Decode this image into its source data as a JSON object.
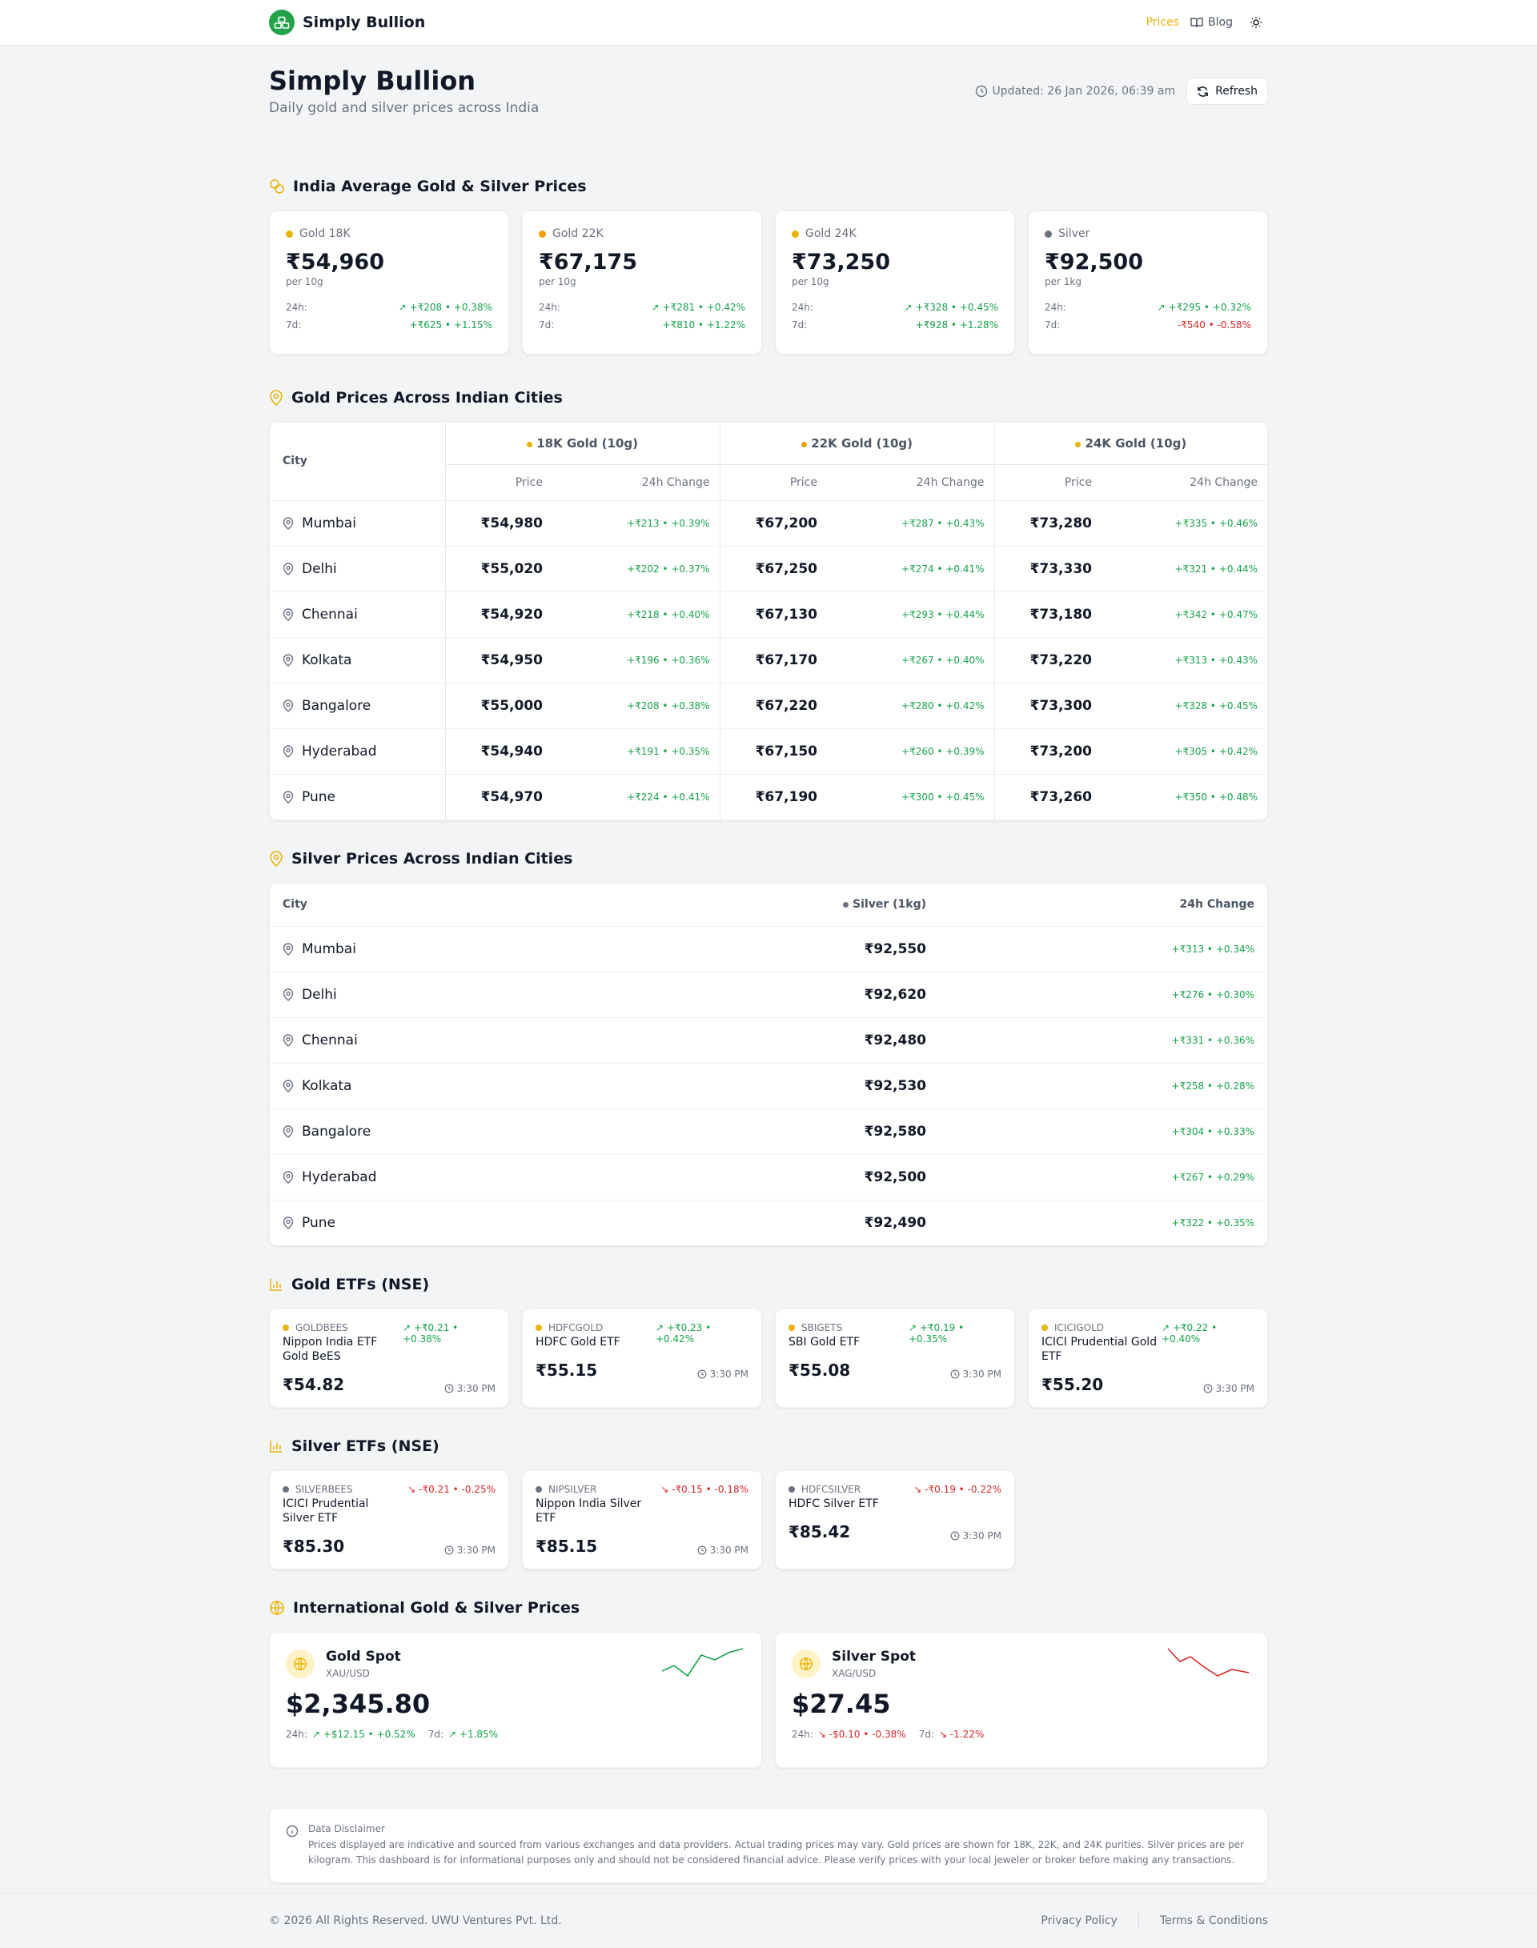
{
  "nav": {
    "brand": "Simply Bullion",
    "prices_label": "Prices",
    "blog_label": "Blog"
  },
  "header": {
    "title": "Simply Bullion",
    "subtitle": "Daily gold and silver prices across India",
    "updated": "Updated: 26 Jan 2026, 06:39 am",
    "refresh_label": "Refresh"
  },
  "colors": {
    "gold18": "#eab308",
    "gold22": "#f59e0b",
    "gold24": "#eab308",
    "silver": "#6b7280",
    "up": "#16a34a",
    "down": "#dc2626"
  },
  "avg": {
    "title": "India Average Gold & Silver Prices",
    "cards": [
      {
        "label": "Gold 18K",
        "price": "₹54,960",
        "unit": "per 10g",
        "k24": "24h:",
        "v24": "↗ +₹208 • +0.38%",
        "k7": "7d:",
        "v7": "+₹625 • +1.15%"
      },
      {
        "label": "Gold 22K",
        "price": "₹67,175",
        "unit": "per 10g",
        "k24": "24h:",
        "v24": "↗ +₹281 • +0.42%",
        "k7": "7d:",
        "v7": "+₹810 • +1.22%"
      },
      {
        "label": "Gold 24K",
        "price": "₹73,250",
        "unit": "per 10g",
        "k24": "24h:",
        "v24": "↗ +₹328 • +0.45%",
        "k7": "7d:",
        "v7": "+₹928 • +1.28%"
      },
      {
        "label": "Silver",
        "price": "₹92,500",
        "unit": "per 1kg",
        "k24": "24h:",
        "v24": "↗ +₹295 • +0.32%",
        "k7": "7d:",
        "v7": "-₹540 • -0.58%"
      }
    ]
  },
  "gold_cities": {
    "title": "Gold Prices Across Indian Cities",
    "city_header": "City",
    "groups": [
      "18K Gold (10g)",
      "22K Gold (10g)",
      "24K Gold (10g)"
    ],
    "price_header": "Price",
    "change_header": "24h Change",
    "rows": [
      {
        "city": "Mumbai",
        "p18": "₹54,980",
        "c18": "+₹213 • +0.39%",
        "p22": "₹67,200",
        "c22": "+₹287 • +0.43%",
        "p24": "₹73,280",
        "c24": "+₹335 • +0.46%"
      },
      {
        "city": "Delhi",
        "p18": "₹55,020",
        "c18": "+₹202 • +0.37%",
        "p22": "₹67,250",
        "c22": "+₹274 • +0.41%",
        "p24": "₹73,330",
        "c24": "+₹321 • +0.44%"
      },
      {
        "city": "Chennai",
        "p18": "₹54,920",
        "c18": "+₹218 • +0.40%",
        "p22": "₹67,130",
        "c22": "+₹293 • +0.44%",
        "p24": "₹73,180",
        "c24": "+₹342 • +0.47%"
      },
      {
        "city": "Kolkata",
        "p18": "₹54,950",
        "c18": "+₹196 • +0.36%",
        "p22": "₹67,170",
        "c22": "+₹267 • +0.40%",
        "p24": "₹73,220",
        "c24": "+₹313 • +0.43%"
      },
      {
        "city": "Bangalore",
        "p18": "₹55,000",
        "c18": "+₹208 • +0.38%",
        "p22": "₹67,220",
        "c22": "+₹280 • +0.42%",
        "p24": "₹73,300",
        "c24": "+₹328 • +0.45%"
      },
      {
        "city": "Hyderabad",
        "p18": "₹54,940",
        "c18": "+₹191 • +0.35%",
        "p22": "₹67,150",
        "c22": "+₹260 • +0.39%",
        "p24": "₹73,200",
        "c24": "+₹305 • +0.42%"
      },
      {
        "city": "Pune",
        "p18": "₹54,970",
        "c18": "+₹224 • +0.41%",
        "p22": "₹67,190",
        "c22": "+₹300 • +0.45%",
        "p24": "₹73,260",
        "c24": "+₹350 • +0.48%"
      }
    ]
  },
  "silver_cities": {
    "title": "Silver Prices Across Indian Cities",
    "city_header": "City",
    "silver_header": "Silver (1kg)",
    "change_header": "24h Change",
    "rows": [
      {
        "city": "Mumbai",
        "price": "₹92,550",
        "change": "+₹313 • +0.34%"
      },
      {
        "city": "Delhi",
        "price": "₹92,620",
        "change": "+₹276 • +0.30%"
      },
      {
        "city": "Chennai",
        "price": "₹92,480",
        "change": "+₹331 • +0.36%"
      },
      {
        "city": "Kolkata",
        "price": "₹92,530",
        "change": "+₹258 • +0.28%"
      },
      {
        "city": "Bangalore",
        "price": "₹92,580",
        "change": "+₹304 • +0.33%"
      },
      {
        "city": "Hyderabad",
        "price": "₹92,500",
        "change": "+₹267 • +0.29%"
      },
      {
        "city": "Pune",
        "price": "₹92,490",
        "change": "+₹322 • +0.35%"
      }
    ]
  },
  "gold_etfs": {
    "title": "Gold ETFs (NSE)",
    "items": [
      {
        "ticker": "GOLDBEES",
        "change": "↗ +₹0.21 • +0.38%",
        "name": "Nippon India ETF Gold BeES",
        "price": "₹54.82",
        "time": "3:30 PM"
      },
      {
        "ticker": "HDFCGOLD",
        "change": "↗ +₹0.23 • +0.42%",
        "name": "HDFC Gold ETF",
        "price": "₹55.15",
        "time": "3:30 PM"
      },
      {
        "ticker": "SBIGETS",
        "change": "↗ +₹0.19 • +0.35%",
        "name": "SBI Gold ETF",
        "price": "₹55.08",
        "time": "3:30 PM"
      },
      {
        "ticker": "ICICIGOLD",
        "change": "↗ +₹0.22 • +0.40%",
        "name": "ICICI Prudential Gold ETF",
        "price": "₹55.20",
        "time": "3:30 PM"
      }
    ]
  },
  "silver_etfs": {
    "title": "Silver ETFs (NSE)",
    "items": [
      {
        "ticker": "SILVERBEES",
        "change": "↘ -₹0.21 • -0.25%",
        "name": "ICICI Prudential Silver ETF",
        "price": "₹85.30",
        "time": "3:30 PM"
      },
      {
        "ticker": "NIPSILVER",
        "change": "↘ -₹0.15 • -0.18%",
        "name": "Nippon India Silver ETF",
        "price": "₹85.15",
        "time": "3:30 PM"
      },
      {
        "ticker": "HDFCSILVER",
        "change": "↘ -₹0.19 • -0.22%",
        "name": "HDFC Silver ETF",
        "price": "₹85.42",
        "time": "3:30 PM"
      }
    ]
  },
  "intl": {
    "title": "International Gold & Silver Prices",
    "gold": {
      "name": "Gold Spot",
      "code": "XAU/USD",
      "price": "$2,345.80",
      "k24": "24h:",
      "v24": "↗ +$12.15 • +0.52%",
      "k7": "7d:",
      "v7": "↗ +1.85%"
    },
    "silver": {
      "name": "Silver Spot",
      "code": "XAG/USD",
      "price": "$27.45",
      "k24": "24h:",
      "v24": "↘ -$0.10 • -0.38%",
      "k7": "7d:",
      "v7": "↘ -1.22%"
    }
  },
  "disclaimer": {
    "title": "Data Disclaimer",
    "text": "Prices displayed are indicative and sourced from various exchanges and data providers. Actual trading prices may vary. Gold prices are shown for 18K, 22K, and 24K purities. Silver prices are per kilogram. This dashboard is for informational purposes only and should not be considered financial advice. Please verify prices with your local jeweler or broker before making any transactions."
  },
  "footer": {
    "copyright": "© 2026 All Rights Reserved. UWU Ventures Pvt. Ltd.",
    "privacy": "Privacy Policy",
    "terms": "Terms & Conditions"
  }
}
